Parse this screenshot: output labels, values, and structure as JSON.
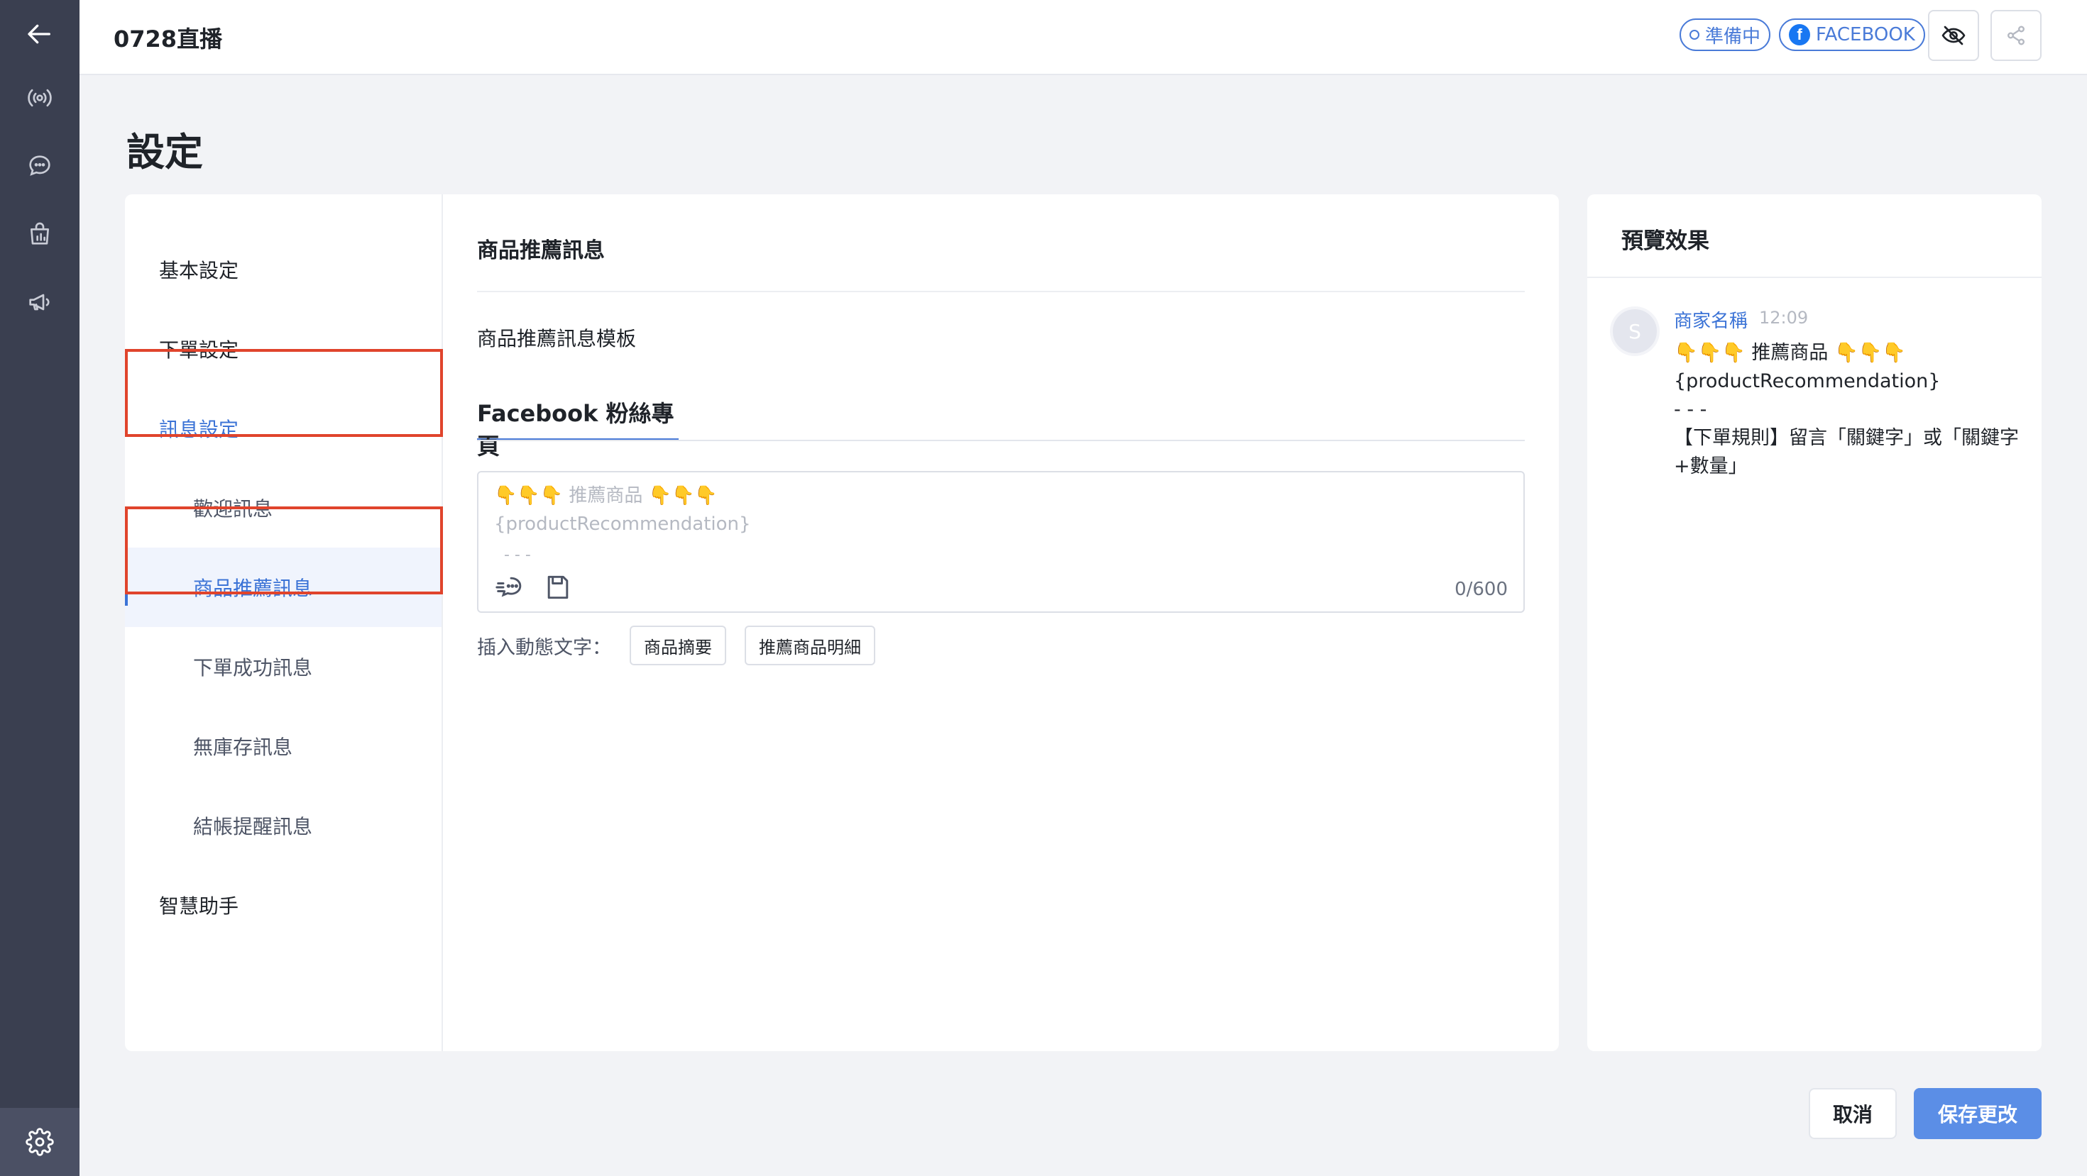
{
  "header": {
    "title": "0728直播",
    "status_chip": "準備中",
    "platform_chip": "FACEBOOK"
  },
  "page": {
    "title": "設定"
  },
  "sidenav": {
    "items": [
      {
        "label": "基本設定"
      },
      {
        "label": "下單設定"
      },
      {
        "label": "訊息設定"
      },
      {
        "label": "歡迎訊息"
      },
      {
        "label": "商品推薦訊息"
      },
      {
        "label": "下單成功訊息"
      },
      {
        "label": "無庫存訊息"
      },
      {
        "label": "結帳提醒訊息"
      },
      {
        "label": "智慧助手"
      }
    ]
  },
  "content": {
    "section_title": "商品推薦訊息",
    "template_title": "商品推薦訊息模板",
    "tab_label": "Facebook 粉絲專頁",
    "editor": {
      "placeholder_line1": "👇👇👇 推薦商品 👇👇👇",
      "placeholder_line2": "{productRecommendation}",
      "placeholder_line3": "- - -",
      "char_count": "0/600"
    },
    "insert_label": "插入動態文字：",
    "insert_buttons": [
      "商品摘要",
      "推薦商品明細"
    ]
  },
  "preview": {
    "title": "預覽效果",
    "avatar_letter": "S",
    "sender": "商家名稱",
    "time": "12:09",
    "lines": [
      "👇👇👇 推薦商品 👇👇👇",
      "{productRecommendation}",
      "- - -",
      "【下單規則】留言「關鍵字」或「關鍵字+數量」"
    ]
  },
  "footer": {
    "cancel_label": "取消",
    "save_label": "保存更改"
  },
  "colors": {
    "accent": "#3b73d6",
    "rail": "#3a3f50",
    "highlight_box": "#e0442c",
    "save_button": "#5b8ee6"
  }
}
